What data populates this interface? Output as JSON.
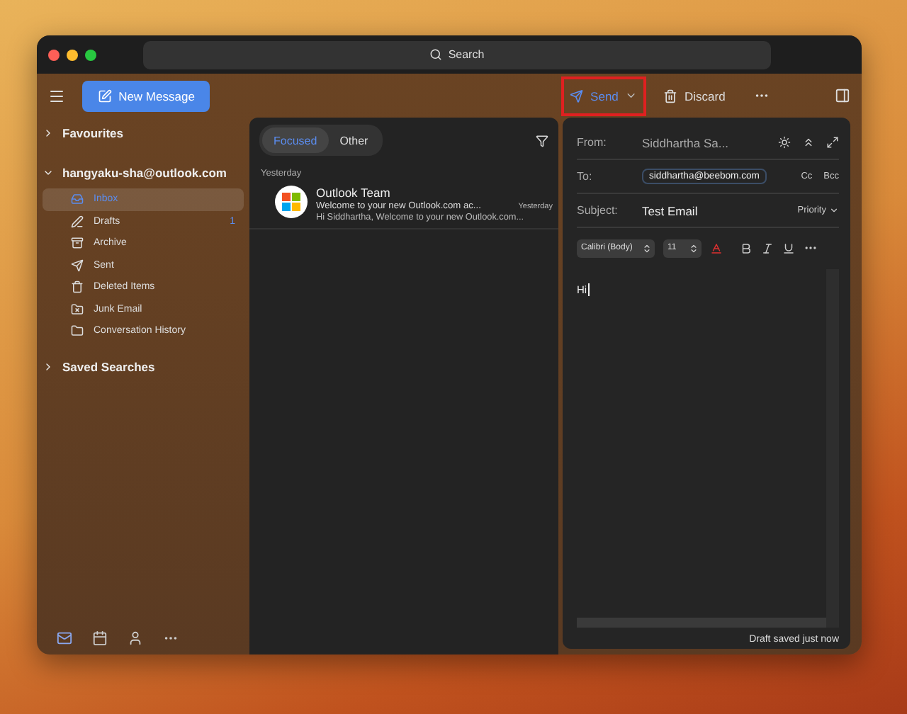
{
  "search": {
    "placeholder": "Search"
  },
  "toolbar": {
    "new_message": "New Message",
    "send": "Send",
    "send_highlighted": true,
    "discard": "Discard"
  },
  "sidebar": {
    "favourites": "Favourites",
    "account": "hangyaku-sha@outlook.com",
    "account_expanded": true,
    "folders": [
      {
        "kind": "inbox",
        "label": "Inbox",
        "selected": true
      },
      {
        "kind": "drafts",
        "label": "Drafts",
        "count": "1",
        "selected": false
      },
      {
        "kind": "archive",
        "label": "Archive",
        "selected": false
      },
      {
        "kind": "sent",
        "label": "Sent",
        "selected": false
      },
      {
        "kind": "deleted",
        "label": "Deleted Items",
        "selected": false
      },
      {
        "kind": "junk",
        "label": "Junk Email",
        "selected": false
      },
      {
        "kind": "history",
        "label": "Conversation History",
        "selected": false
      }
    ],
    "saved_searches": "Saved Searches",
    "nav": [
      {
        "kind": "mail",
        "selected": true
      },
      {
        "kind": "calendar",
        "selected": false
      },
      {
        "kind": "people",
        "selected": false
      },
      {
        "kind": "more",
        "selected": false
      }
    ]
  },
  "message_list": {
    "tabs": [
      {
        "label": "Focused",
        "selected": true
      },
      {
        "label": "Other",
        "selected": false
      }
    ],
    "group": "Yesterday",
    "messages": [
      {
        "sender": "Outlook Team",
        "subject": "Welcome to your new Outlook.com ac...",
        "date": "Yesterday",
        "preview": "Hi Siddhartha, Welcome to your new Outlook.com..."
      }
    ]
  },
  "compose": {
    "from_label": "From:",
    "from": "Siddhartha Sa...",
    "to_label": "To:",
    "recipients": [
      "siddhartha@beebom.com"
    ],
    "cc": "Cc",
    "bcc": "Bcc",
    "subject_label": "Subject:",
    "subject": "Test Email",
    "priority": "Priority",
    "font": "Calibri (Body)",
    "size": "11",
    "body": "Hi",
    "status": "Draft saved just now"
  }
}
